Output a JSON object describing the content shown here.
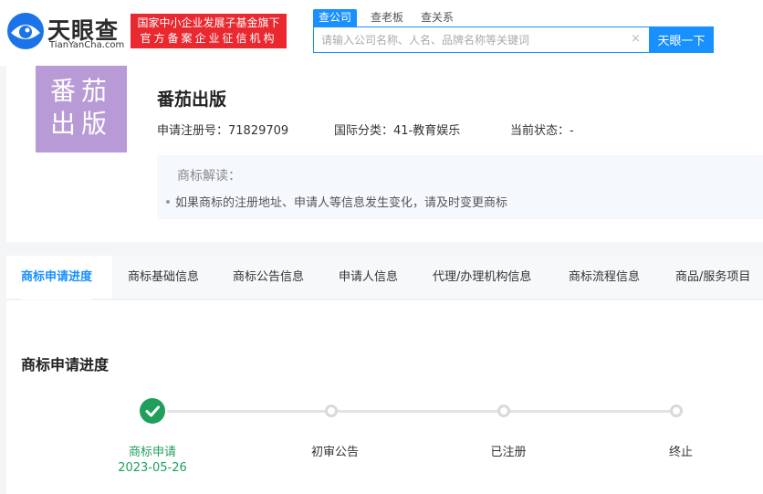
{
  "header": {
    "logo": {
      "name": "天眼查",
      "url": "TianYanCha.com"
    },
    "badge": {
      "line1": "国家中小企业发展子基金旗下",
      "line2": "官方备案企业征信机构"
    },
    "search_tabs": [
      "查公司",
      "查老板",
      "查关系"
    ],
    "search": {
      "placeholder": "请输入公司名称、人名、品牌名称等关键词",
      "clear": "×",
      "button": "天眼一下"
    }
  },
  "trademark": {
    "image_text": {
      "line1": "番茄",
      "line2": "出版"
    },
    "name": "番茄出版",
    "reg_no": "申请注册号：71829709",
    "class": "国际分类：41-教育娱乐",
    "status": "当前状态：-",
    "interpretation": {
      "title": "商标解读：",
      "items": [
        "如果商标的注册地址、申请人等信息发生变化，请及时变更商标"
      ]
    }
  },
  "tabs": [
    "商标申请进度",
    "商标基础信息",
    "商标公告信息",
    "申请人信息",
    "代理/办理机构信息",
    "商标流程信息",
    "商品/服务项目"
  ],
  "progress": {
    "title": "商标申请进度",
    "steps": [
      {
        "label": "商标申请",
        "date": "2023-05-26",
        "done": true
      },
      {
        "label": "初审公告",
        "date": "",
        "done": false
      },
      {
        "label": "已注册",
        "date": "",
        "done": false
      },
      {
        "label": "终止",
        "date": "",
        "done": false
      }
    ]
  },
  "colors": {
    "accent": "#1890ff",
    "success": "#1f9f5b",
    "badge": "#e9292f",
    "tm_bg": "#b79ad6"
  }
}
